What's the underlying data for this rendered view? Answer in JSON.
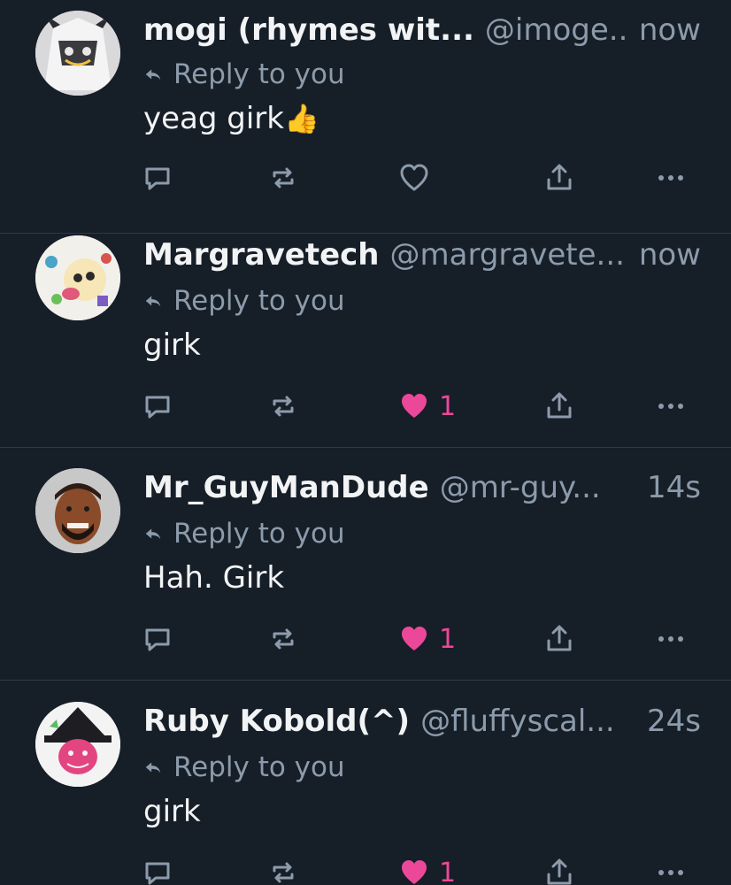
{
  "colors": {
    "background": "#161e27",
    "divider": "#2e3a47",
    "text_primary": "#f1f3f5",
    "text_secondary": "#8c9bab",
    "like_active": "#ec4899"
  },
  "icons": {
    "reply": "reply-arrow-icon",
    "comment": "comment-icon",
    "repost": "repost-icon",
    "like": "heart-icon",
    "share": "share-icon",
    "more": "more-icon"
  },
  "posts": [
    {
      "display_name": "mogi (rhymes wit...",
      "handle": "@imoge..",
      "time": "now",
      "reply_label": "Reply to you",
      "text": "yeag girk",
      "emoji": "👍",
      "liked": false,
      "like_count": ""
    },
    {
      "display_name": "Margravetech",
      "handle": "@margravete...",
      "time": "now",
      "reply_label": "Reply to you",
      "text": "girk",
      "liked": true,
      "like_count": "1"
    },
    {
      "display_name": "Mr_GuyManDude",
      "handle": "@mr-guy...",
      "time": "14s",
      "reply_label": "Reply to you",
      "text": "Hah. Girk",
      "liked": true,
      "like_count": "1"
    },
    {
      "display_name": "Ruby Kobold(^)",
      "handle": "@fluffyscal...",
      "time": "24s",
      "reply_label": "Reply to you",
      "text": "girk",
      "liked": true,
      "like_count": "1"
    }
  ]
}
